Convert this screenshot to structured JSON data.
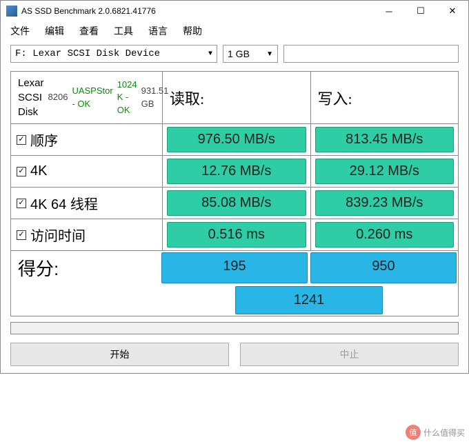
{
  "window": {
    "title": "AS SSD Benchmark 2.0.6821.41776"
  },
  "menu": {
    "file": "文件",
    "edit": "编辑",
    "view": "查看",
    "tools": "工具",
    "language": "语言",
    "help": "帮助"
  },
  "toolbar": {
    "drive": "F: Lexar  SCSI Disk Device",
    "size": "1 GB"
  },
  "info": {
    "name": "Lexar SCSI Disk",
    "model": "8206",
    "driver": "UASPStor - OK",
    "align": "1024 K - OK",
    "capacity": "931.51 GB"
  },
  "headers": {
    "read": "读取:",
    "write": "写入:"
  },
  "tests": {
    "seq": {
      "label": "顺序",
      "read": "976.50 MB/s",
      "write": "813.45 MB/s"
    },
    "fk": {
      "label": "4K",
      "read": "12.76 MB/s",
      "write": "29.12 MB/s"
    },
    "fk64": {
      "label": "4K 64 线程",
      "read": "85.08 MB/s",
      "write": "839.23 MB/s"
    },
    "access": {
      "label": "访问时间",
      "read": "0.516 ms",
      "write": "0.260 ms"
    }
  },
  "score": {
    "label": "得分:",
    "read": "195",
    "write": "950",
    "total": "1241"
  },
  "buttons": {
    "start": "开始",
    "abort": "中止"
  },
  "watermark": {
    "icon": "值",
    "text": "什么值得买"
  }
}
